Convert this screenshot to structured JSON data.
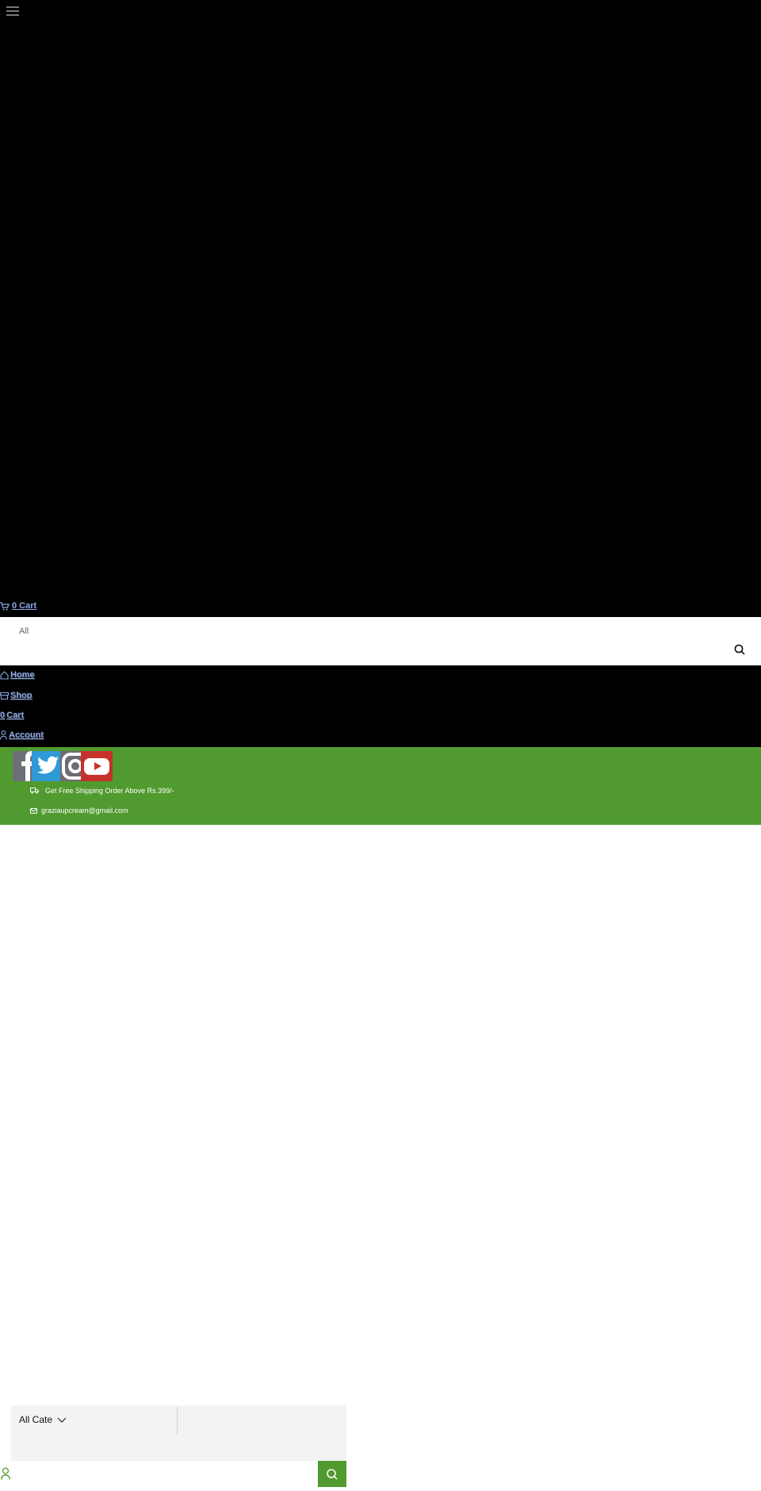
{
  "header": {
    "menu_icon": "hamburger-icon",
    "cart_label": "0 Cart"
  },
  "search": {
    "category": "All",
    "button_icon": "search-icon"
  },
  "nav": {
    "items": [
      {
        "label": "Home",
        "icon": "home-icon"
      },
      {
        "label": "Shop",
        "icon": "store-icon"
      },
      {
        "label": "Cart",
        "count": "0"
      },
      {
        "label": "Account",
        "icon": "user-icon"
      }
    ]
  },
  "topbar": {
    "background": "#519a2f",
    "socials": [
      {
        "name": "facebook",
        "icon": "facebook-icon",
        "color": "#6d6f76"
      },
      {
        "name": "twitter",
        "icon": "twitter-icon",
        "color": "#2f9ad6"
      },
      {
        "name": "instagram",
        "icon": "instagram-icon",
        "color": "#6c6c72"
      },
      {
        "name": "youtube",
        "icon": "youtube-icon",
        "color": "#c7312c"
      }
    ],
    "shipping_text": "Get Free Shipping Order Above Rs.399/-",
    "email": "graziaupcream@gmail.com"
  },
  "bottom_search": {
    "category": "All Categories",
    "accent": "#519a2f"
  }
}
